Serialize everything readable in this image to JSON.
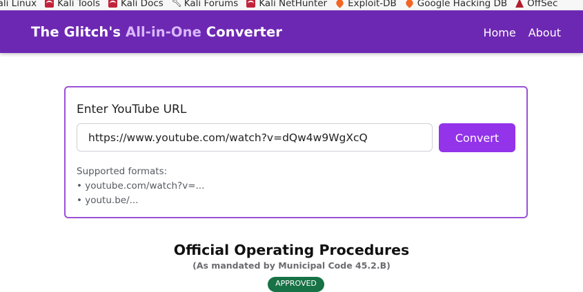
{
  "bookmarks": [
    {
      "label": "Kali Linux",
      "icon": "none"
    },
    {
      "label": "Kali Tools",
      "icon": "kali-icon"
    },
    {
      "label": "Kali Docs",
      "icon": "kali-icon"
    },
    {
      "label": "Kali Forums",
      "icon": "wrench-icon"
    },
    {
      "label": "Kali NetHunter",
      "icon": "kali-icon"
    },
    {
      "label": "Exploit-DB",
      "icon": "flame-icon"
    },
    {
      "label": "Google Hacking DB",
      "icon": "flame-icon"
    },
    {
      "label": "OffSec",
      "icon": "offsec-icon"
    }
  ],
  "header": {
    "brand_prefix": "The Glitch's ",
    "brand_accent": "All-in-One",
    "brand_suffix": " Converter",
    "nav": {
      "home": "Home",
      "about": "About"
    },
    "bg_color": "#6d28b3",
    "accent_color": "#d9b8ff"
  },
  "converter": {
    "label": "Enter YouTube URL",
    "url_value": "https://www.youtube.com/watch?v=dQw4w9WgXcQ",
    "button_label": "Convert",
    "button_color": "#9333ea",
    "formats_title": "Supported formats:",
    "formats": [
      "• youtube.com/watch?v=...",
      "• youtu.be/..."
    ]
  },
  "procedures": {
    "title": "Official Operating Procedures",
    "subtitle": "(As mandated by Municipal Code 45.2.B)",
    "badge": "APPROVED",
    "badge_color": "#177245"
  }
}
